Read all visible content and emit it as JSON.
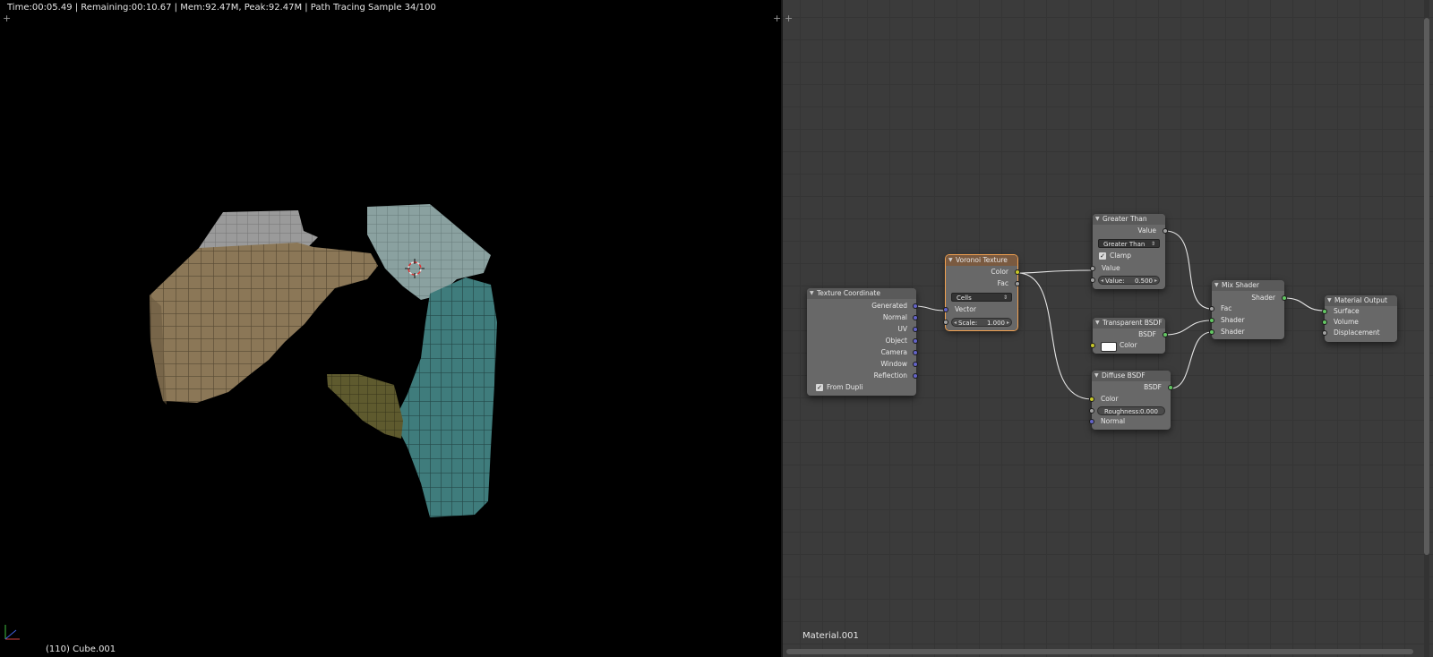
{
  "viewport": {
    "render_status": "Time:00:05.49 | Remaining:00:10.67 | Mem:92.47M, Peak:92.47M | Path Tracing Sample 34/100",
    "object_label": "(110) Cube.001",
    "corner_mark": "+"
  },
  "node_editor": {
    "material_name": "Material.001",
    "nodes": {
      "texture_coordinate": {
        "title": "Texture Coordinate",
        "outputs": [
          "Generated",
          "Normal",
          "UV",
          "Object",
          "Camera",
          "Window",
          "Reflection"
        ],
        "from_dupli_label": "From Dupli",
        "from_dupli_checked": true
      },
      "voronoi": {
        "title": "Voronoi Texture",
        "outputs": [
          "Color",
          "Fac"
        ],
        "coloring": "Cells",
        "vector_label": "Vector",
        "scale_label": "Scale:",
        "scale_value": "1.000"
      },
      "greater_than": {
        "title": "Greater Than",
        "output": "Value",
        "operation": "Greater Than",
        "clamp_label": "Clamp",
        "clamp_checked": true,
        "input_label": "Value",
        "value_label": "Value:",
        "value": "0.500"
      },
      "transparent": {
        "title": "Transparent BSDF",
        "output": "BSDF",
        "color_label": "Color",
        "color": "#ffffff"
      },
      "diffuse": {
        "title": "Diffuse BSDF",
        "output": "BSDF",
        "color_label": "Color",
        "roughness_label": "Roughness:",
        "roughness_value": "0.000",
        "normal_label": "Normal"
      },
      "mix_shader": {
        "title": "Mix Shader",
        "output": "Shader",
        "inputs": [
          "Fac",
          "Shader",
          "Shader"
        ]
      },
      "material_output": {
        "title": "Material Output",
        "inputs": [
          "Surface",
          "Volume",
          "Displacement"
        ]
      }
    }
  },
  "colors": {
    "socket_vector": "#6363c7",
    "socket_color": "#c7c729",
    "socket_value": "#a1a1a1",
    "socket_shader": "#63c763",
    "active_node_outline": "#f0a050",
    "link": "#e6e6e6"
  }
}
